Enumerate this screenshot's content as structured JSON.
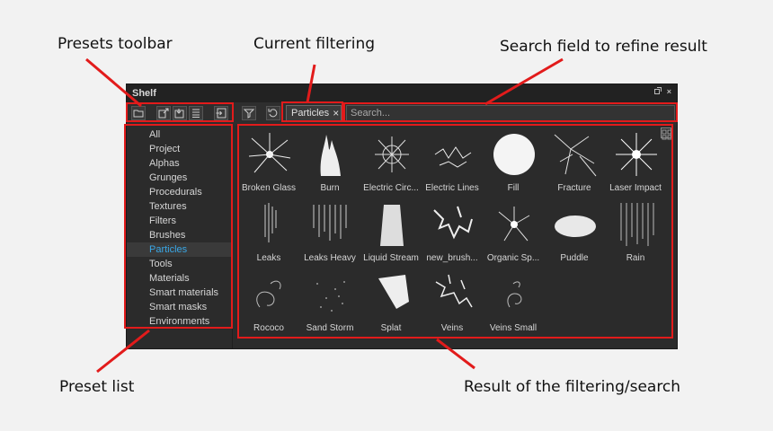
{
  "callouts": {
    "presets_toolbar": "Presets toolbar",
    "current_filtering": "Current filtering",
    "search_field": "Search field to refine result",
    "preset_list": "Preset list",
    "result": "Result of the filtering/search"
  },
  "window": {
    "title": "Shelf",
    "popout_icon": "popout-icon",
    "close_glyph": "×"
  },
  "toolbar": {
    "icons": [
      "folder-icon",
      "export-icon",
      "import-icon",
      "list-icon",
      "save-icon"
    ],
    "filter_icon": "filter-icon",
    "reset_icon": "reset-icon"
  },
  "filter_chip": {
    "label": "Particles",
    "close_glyph": "×"
  },
  "search": {
    "placeholder": "Search..."
  },
  "preset_list": {
    "selected": "Particles",
    "items": [
      "All",
      "Project",
      "Alphas",
      "Grunges",
      "Procedurals",
      "Textures",
      "Filters",
      "Brushes",
      "Particles",
      "Tools",
      "Materials",
      "Smart materials",
      "Smart masks",
      "Environments"
    ]
  },
  "results": {
    "items": [
      "Broken Glass",
      "Burn",
      "Electric Circ...",
      "Electric Lines",
      "Fill",
      "Fracture",
      "Laser Impact",
      "Leaks",
      "Leaks Heavy",
      "Liquid Stream",
      "new_brush...",
      "Organic Sp...",
      "Puddle",
      "Rain",
      "Rococo",
      "Sand Storm",
      "Splat",
      "Veins",
      "Veins Small"
    ]
  },
  "colors": {
    "accent": "#39a7e6",
    "annotation": "#e21b1b",
    "panel_bg": "#2b2b2b"
  }
}
